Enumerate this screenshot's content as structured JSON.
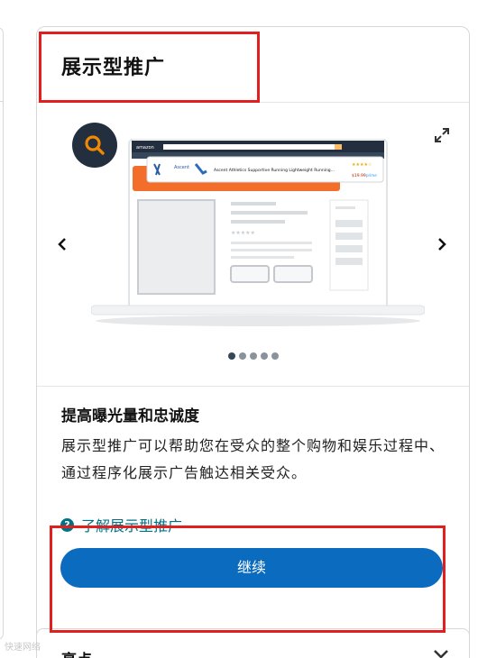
{
  "card": {
    "title": "展示型推广",
    "carousel": {
      "total_slides": 5,
      "active_index": 0,
      "mock_product_text": "Ascent Athletics Supportive Running Lightweight Running...",
      "mock_brand": "Ascent",
      "mock_logo": "amazon",
      "mock_price": "$19.99",
      "mock_badge": "prime"
    },
    "benefit_title": "提高曝光量和忠诚度",
    "benefit_description": "展示型推广可以帮助您在受众的整个购物和娱乐过程中、通过程序化展示广告触达相关受众。",
    "learn_more_label": "了解展示型推广",
    "continue_label": "继续"
  },
  "next_card": {
    "title": "亮点"
  },
  "watermark": "快速网络",
  "colors": {
    "accent_button": "#0a6bbf",
    "link": "#007185",
    "annotation": "#e02020",
    "badge_bg": "#232f3e",
    "badge_icon": "#f08804"
  }
}
